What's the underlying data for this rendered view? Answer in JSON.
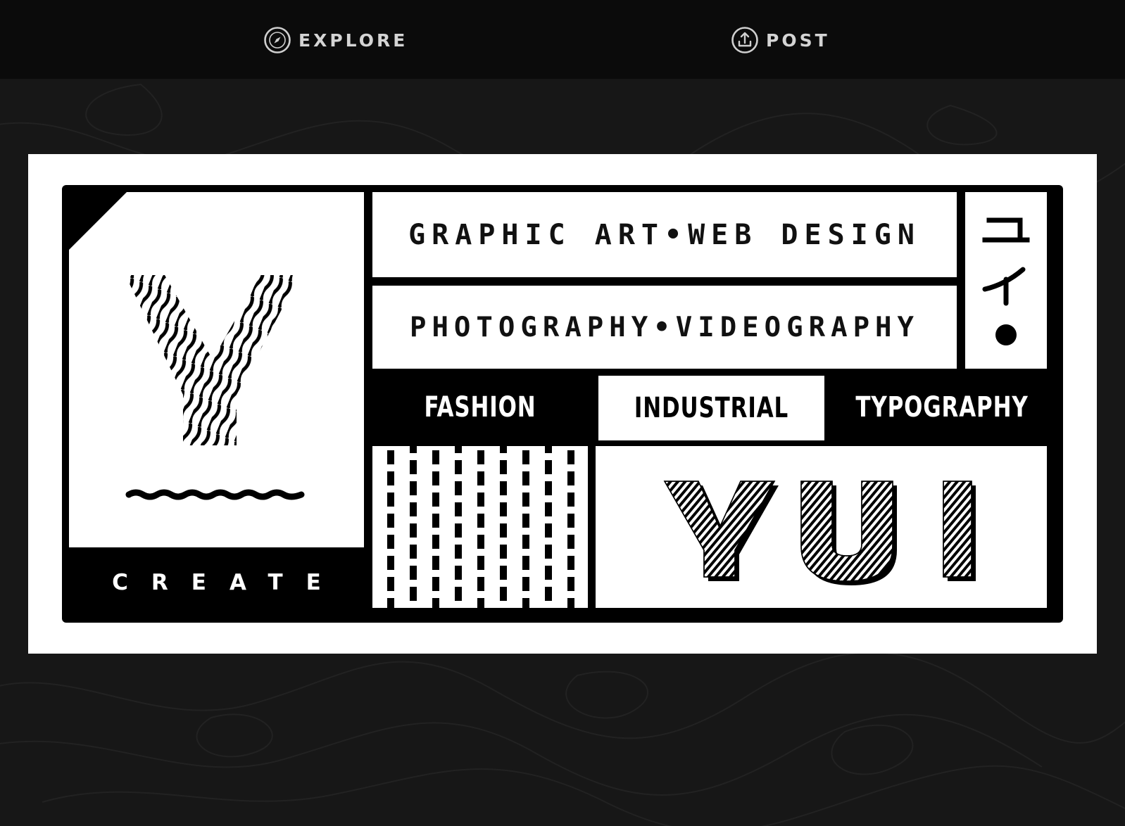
{
  "nav": {
    "items": [
      {
        "label": "EXPLORE",
        "icon": "compass-icon"
      },
      {
        "label": "POST",
        "icon": "upload-icon"
      }
    ]
  },
  "banner": {
    "headline_1": "GRAPHIC ART•WEB DESIGN",
    "headline_2": "PHOTOGRAPHY•VIDEOGRAPHY",
    "kana": "ユイ",
    "tags": [
      "FASHION",
      "INDUSTRIAL",
      "TYPOGRAPHY"
    ],
    "create_label": "CREATE",
    "logo_text": "YUI",
    "monogram": "Y"
  },
  "colors": {
    "page_background": "#171717",
    "nav_background": "#0b0b0b",
    "nav_text": "#d4d4d4",
    "banner_black": "#000000",
    "banner_white": "#ffffff"
  }
}
